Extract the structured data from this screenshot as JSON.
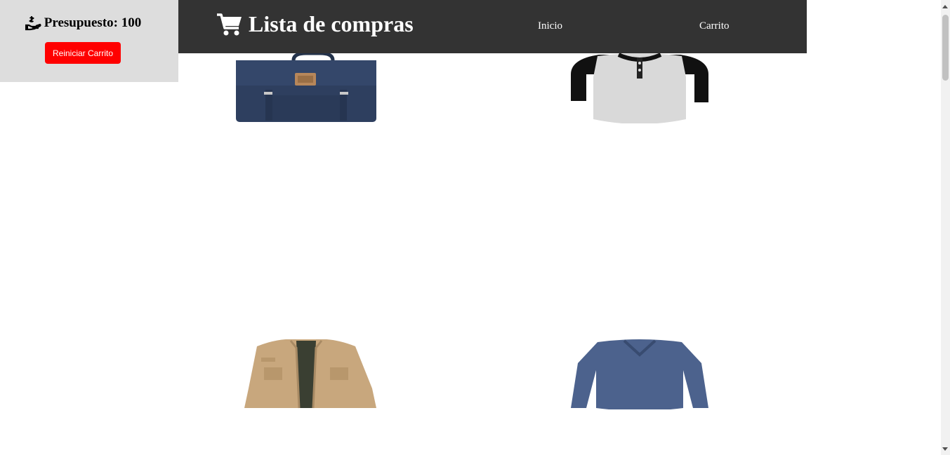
{
  "budget": {
    "icon": "hand-coin-icon",
    "label": "Presupuesto: 100",
    "reset_label": "Reiniciar Carrito",
    "reset_color": "#ff0000"
  },
  "header": {
    "icon": "shopping-cart-icon",
    "title": "Lista de compras",
    "background": "#333333",
    "nav": [
      {
        "label": "Inicio"
      },
      {
        "label": "Carrito"
      }
    ]
  },
  "products": [
    {
      "name": "bag"
    },
    {
      "name": "henley-shirt"
    },
    {
      "name": "jacket"
    },
    {
      "name": "vneck-shirt"
    }
  ]
}
